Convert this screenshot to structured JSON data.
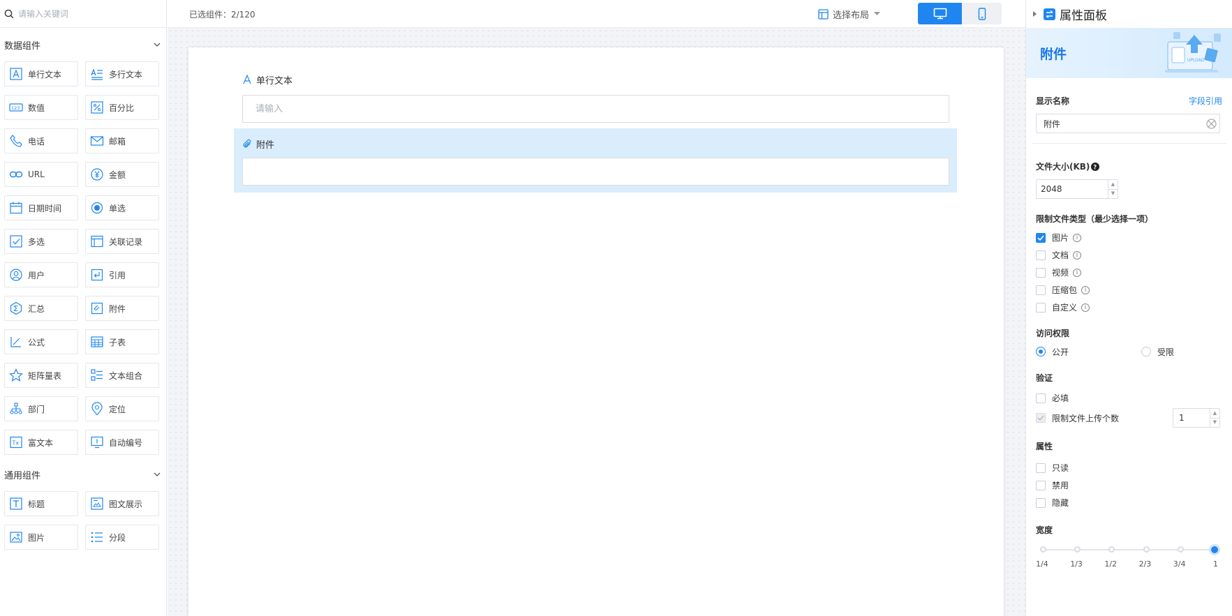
{
  "sidebar": {
    "search_placeholder": "请输入关键词",
    "group1": {
      "title": "数据组件",
      "items": [
        {
          "label": "单行文本",
          "icon": "text-a-icon"
        },
        {
          "label": "多行文本",
          "icon": "multiline-text-icon"
        },
        {
          "label": "数值",
          "icon": "number-icon"
        },
        {
          "label": "百分比",
          "icon": "percent-icon"
        },
        {
          "label": "电话",
          "icon": "phone-icon"
        },
        {
          "label": "邮箱",
          "icon": "mail-icon"
        },
        {
          "label": "URL",
          "icon": "link-icon"
        },
        {
          "label": "金额",
          "icon": "yen-icon"
        },
        {
          "label": "日期时间",
          "icon": "calendar-icon"
        },
        {
          "label": "单选",
          "icon": "radio-icon"
        },
        {
          "label": "多选",
          "icon": "checkbox-icon"
        },
        {
          "label": "关联记录",
          "icon": "related-record-icon"
        },
        {
          "label": "用户",
          "icon": "user-icon"
        },
        {
          "label": "引用",
          "icon": "reference-icon"
        },
        {
          "label": "汇总",
          "icon": "summary-icon"
        },
        {
          "label": "附件",
          "icon": "attachment-icon"
        },
        {
          "label": "公式",
          "icon": "formula-icon"
        },
        {
          "label": "子表",
          "icon": "subtable-icon"
        },
        {
          "label": "矩阵量表",
          "icon": "star-icon"
        },
        {
          "label": "文本组合",
          "icon": "text-combo-icon"
        },
        {
          "label": "部门",
          "icon": "org-icon"
        },
        {
          "label": "定位",
          "icon": "location-icon"
        },
        {
          "label": "富文本",
          "icon": "rich-text-icon"
        },
        {
          "label": "自动编号",
          "icon": "auto-number-icon"
        }
      ]
    },
    "group2": {
      "title": "通用组件",
      "items": [
        {
          "label": "标题",
          "icon": "title-icon"
        },
        {
          "label": "图文展示",
          "icon": "image-text-icon"
        },
        {
          "label": "图片",
          "icon": "image-icon"
        },
        {
          "label": "分段",
          "icon": "section-icon"
        }
      ]
    }
  },
  "topbar": {
    "selected_count": "已选组件：2/120",
    "layout_label": "选择布局"
  },
  "canvas": {
    "field1": {
      "label": "单行文本",
      "placeholder": "请输入"
    },
    "field2": {
      "label": "附件"
    }
  },
  "panel": {
    "title": "属性面板",
    "banner_title": "附件",
    "display_name": {
      "label": "显示名称",
      "link": "字段引用",
      "value": "附件"
    },
    "file_size": {
      "label": "文件大小(KB)",
      "value": "2048"
    },
    "file_types": {
      "label": "限制文件类型（最少选择一项）",
      "options": [
        {
          "label": "图片",
          "checked": true
        },
        {
          "label": "文档",
          "checked": false
        },
        {
          "label": "视频",
          "checked": false
        },
        {
          "label": "压缩包",
          "checked": false
        },
        {
          "label": "自定义",
          "checked": false
        }
      ]
    },
    "access": {
      "label": "访问权限",
      "options": [
        {
          "label": "公开",
          "selected": true
        },
        {
          "label": "受限",
          "selected": false
        }
      ]
    },
    "validation": {
      "label": "验证",
      "required": "必填",
      "limit_count": "限制文件上传个数",
      "limit_value": "1"
    },
    "attributes": {
      "label": "属性",
      "options": [
        "只读",
        "禁用",
        "隐藏"
      ]
    },
    "width": {
      "label": "宽度",
      "ticks": [
        "1/4",
        "1/3",
        "1/2",
        "2/3",
        "3/4",
        "1"
      ],
      "selected_index": 5
    }
  },
  "colors": {
    "accent": "#1f86f0",
    "selected_field_bg": "#daedfd"
  }
}
